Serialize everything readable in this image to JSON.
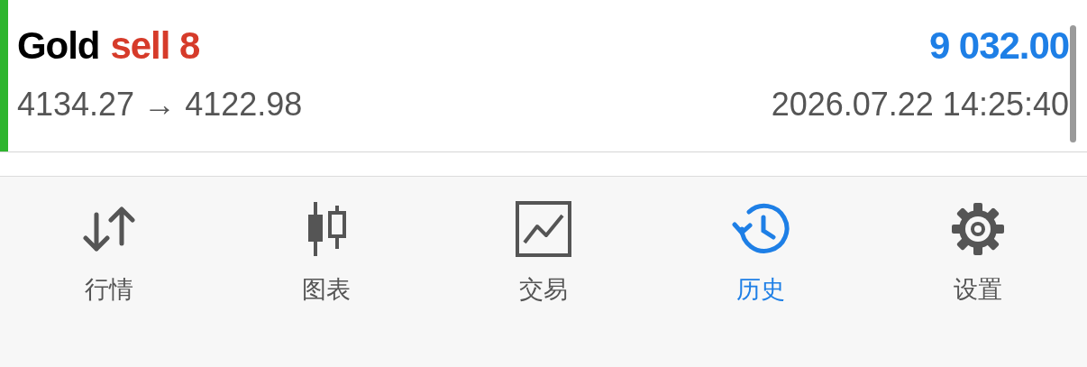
{
  "trade": {
    "symbol": "Gold",
    "side": {
      "text": "sell",
      "kind": "sell"
    },
    "volume": "8",
    "profit": "9 032.00",
    "prices": "4134.27 → 4122.98",
    "time": "2026.07.22 14:25:40"
  },
  "tabs": [
    {
      "label": "行情",
      "kind": "quotes",
      "selected": false
    },
    {
      "label": "图表",
      "kind": "chart",
      "selected": false
    },
    {
      "label": "交易",
      "kind": "trade",
      "selected": false
    },
    {
      "label": "历史",
      "kind": "history",
      "selected": true
    },
    {
      "label": "设置",
      "kind": "settings",
      "selected": false
    }
  ]
}
